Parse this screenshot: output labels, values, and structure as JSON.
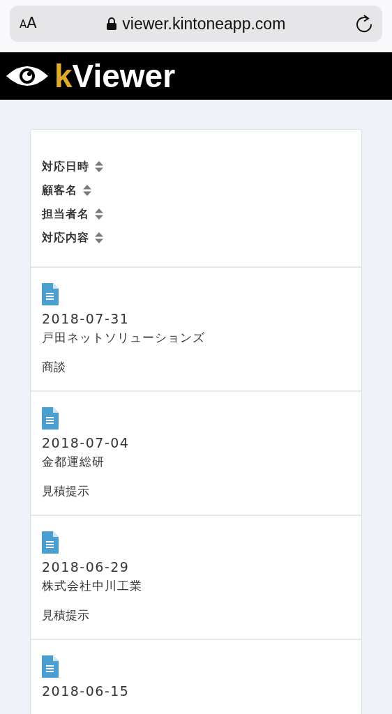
{
  "browser": {
    "text_size": "AA",
    "url": "viewer.kintoneapp.com"
  },
  "brand": {
    "letter": "k",
    "name": "Viewer"
  },
  "sort_fields": [
    {
      "label": "対応日時"
    },
    {
      "label": "顧客名"
    },
    {
      "label": "担当者名"
    },
    {
      "label": "対応内容"
    }
  ],
  "records": [
    {
      "date": "2018-07-31",
      "customer": "戸田ネットソリューションズ",
      "activity": "商談"
    },
    {
      "date": "2018-07-04",
      "customer": "金都運総研",
      "activity": "見積提示"
    },
    {
      "date": "2018-06-29",
      "customer": "株式会社中川工業",
      "activity": "見積提示"
    },
    {
      "date": "2018-06-15"
    }
  ]
}
